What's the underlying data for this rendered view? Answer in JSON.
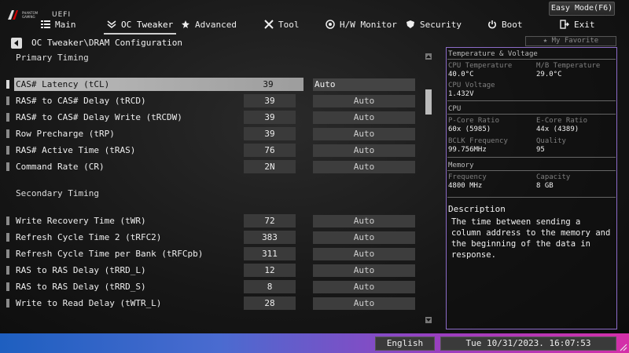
{
  "header": {
    "logo_line1": "PHANTOM",
    "logo_line2": "GAMING",
    "logo_uefi": "UEFI",
    "easy_mode": "Easy Mode(F6)",
    "favorite": "My Favorite"
  },
  "nav": [
    {
      "label": "Main",
      "icon": "list-icon"
    },
    {
      "label": "OC Tweaker",
      "icon": "chevrons-icon",
      "active": true
    },
    {
      "label": "Advanced",
      "icon": "star-arrow-icon"
    },
    {
      "label": "Tool",
      "icon": "tools-icon"
    },
    {
      "label": "H/W Monitor",
      "icon": "monitor-icon"
    },
    {
      "label": "Security",
      "icon": "shield-icon"
    },
    {
      "label": "Boot",
      "icon": "power-icon"
    },
    {
      "label": "Exit",
      "icon": "exit-icon"
    }
  ],
  "breadcrumb": "OC Tweaker\\DRAM Configuration",
  "sections": {
    "primary": "Primary Timing",
    "secondary": "Secondary Timing"
  },
  "rows": [
    {
      "label": "CAS# Latency (tCL)",
      "value": "39",
      "option": "Auto",
      "selected": true
    },
    {
      "label": "RAS# to CAS# Delay (tRCD)",
      "value": "39",
      "option": "Auto"
    },
    {
      "label": "RAS# to CAS# Delay Write (tRCDW)",
      "value": "39",
      "option": "Auto"
    },
    {
      "label": "Row Precharge (tRP)",
      "value": "39",
      "option": "Auto"
    },
    {
      "label": "RAS# Active Time (tRAS)",
      "value": "76",
      "option": "Auto"
    },
    {
      "label": "Command Rate (CR)",
      "value": "2N",
      "option": "Auto"
    },
    {
      "label": "Write Recovery Time (tWR)",
      "value": "72",
      "option": "Auto"
    },
    {
      "label": "Refresh Cycle Time 2 (tRFC2)",
      "value": "383",
      "option": "Auto"
    },
    {
      "label": "Refresh Cycle Time per Bank (tRFCpb)",
      "value": "311",
      "option": "Auto"
    },
    {
      "label": "RAS to RAS Delay (tRRD_L)",
      "value": "12",
      "option": "Auto"
    },
    {
      "label": "RAS to RAS Delay (tRRD_S)",
      "value": "8",
      "option": "Auto"
    },
    {
      "label": "Write to Read Delay (tWTR_L)",
      "value": "28",
      "option": "Auto"
    }
  ],
  "panel": {
    "temp_head": "Temperature & Voltage",
    "cpu_temp_k": "CPU Temperature",
    "cpu_temp_v": "40.0°C",
    "mb_temp_k": "M/B Temperature",
    "mb_temp_v": "29.0°C",
    "cpu_volt_k": "CPU Voltage",
    "cpu_volt_v": "1.432V",
    "cpu_head": "CPU",
    "pcore_k": "P-Core Ratio",
    "pcore_v": "60x (5985)",
    "ecore_k": "E-Core Ratio",
    "ecore_v": "44x (4389)",
    "bclk_k": "BCLK Frequency",
    "bclk_v": "99.756MHz",
    "quality_k": "Quality",
    "quality_v": "95",
    "mem_head": "Memory",
    "freq_k": "Frequency",
    "freq_v": "4800 MHz",
    "cap_k": "Capacity",
    "cap_v": "8 GB",
    "desc_title": "Description",
    "desc_text": "The time between sending a column address to the memory and the beginning of the data in response."
  },
  "footer": {
    "language": "English",
    "datetime": "Tue 10/31/2023. 16:07:53"
  },
  "colors": {
    "panel_border": "#8d6cc9",
    "bar_left": "#1e5fc0",
    "bar_right": "#d52fa8"
  }
}
